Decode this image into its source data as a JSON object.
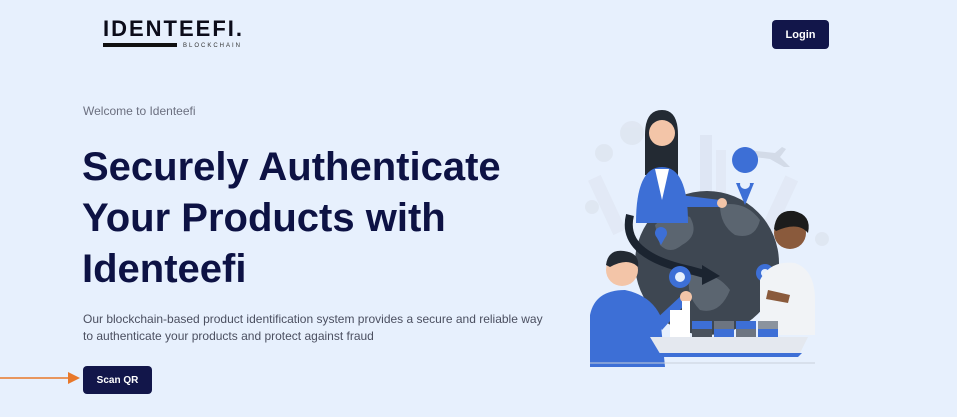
{
  "header": {
    "logo_text": "IDENTEEFI.",
    "logo_subtext": "BLOCKCHAIN",
    "login_label": "Login"
  },
  "hero": {
    "eyebrow": "Welcome to Identeefi",
    "headline_line1": "Securely Authenticate",
    "headline_line2": "Your Products with",
    "headline_line3": "Identeefi",
    "description": "Our blockchain-based product identification system provides a secure and reliable way to authenticate your products and protect against fraud",
    "cta_label": "Scan QR"
  },
  "colors": {
    "background": "#e7f0fd",
    "primary": "#12164a",
    "accent_blue": "#3d6fd6",
    "annotation_arrow": "#e8782a"
  }
}
